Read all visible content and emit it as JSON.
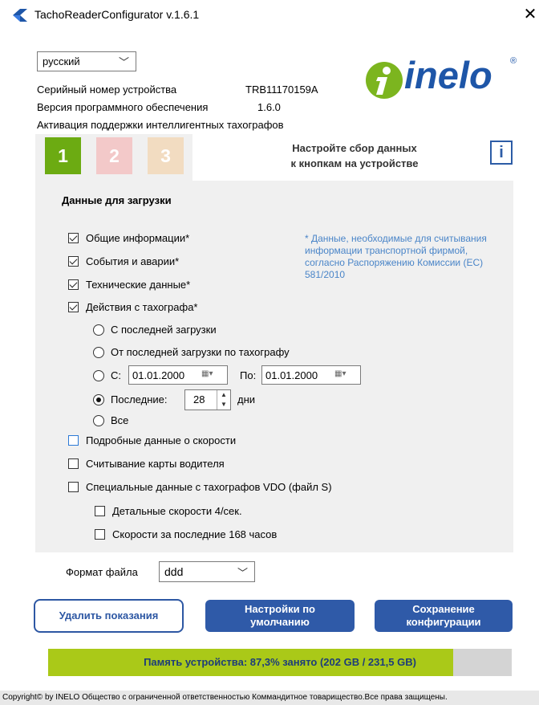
{
  "window": {
    "title": "TachoReaderConfigurator v.1.6.1",
    "close_glyph": "✕"
  },
  "language": {
    "selected": "русский"
  },
  "device": {
    "serial_label": "Серийный номер устройства",
    "serial_value": "TRB11170159A",
    "firmware_label": "Версия программного обеспечения",
    "firmware_value": "1.6.0",
    "smart_tacho_label": "Активация поддержки интеллигентных тахографов"
  },
  "logo": {
    "text": "inelo",
    "reg": "®",
    "brand_color": "#1e56a8",
    "accent_color": "#7cb51f"
  },
  "tabs": [
    {
      "label": "1",
      "color": "#6cab12"
    },
    {
      "label": "2",
      "color": "#f3c9c9"
    },
    {
      "label": "3",
      "color": "#f2dcc1"
    }
  ],
  "hint": {
    "line1": "Настройте сбор данных",
    "line2": "к кнопкам на устройстве"
  },
  "info_button": {
    "label": "i"
  },
  "download": {
    "title": "Данные для загрузки",
    "note": "* Данные, необходимые для считывания информации транспортной фирмой, согласно Распоряжению Комиссии (ЕС) 581/2010",
    "options": {
      "general": {
        "label": "Общие информации*",
        "checked": true
      },
      "events": {
        "label": "События и аварии*",
        "checked": true
      },
      "technical": {
        "label": "Технические данные*",
        "checked": true
      },
      "activities": {
        "label": "Действия с тахографа*",
        "checked": true
      },
      "detailed_speed": {
        "label": "Подробные данные о скорости",
        "checked": false
      },
      "driver_card": {
        "label": "Считывание карты водителя",
        "checked": false
      },
      "vdo_special": {
        "label": "Специальные данные с тахографов VDO (файл S)",
        "checked": false
      },
      "speed_4s": {
        "label": "Детальные скорости 4/сек.",
        "checked": false
      },
      "speed_168h": {
        "label": "Скорости за последние 168 часов",
        "checked": false
      }
    },
    "range": {
      "since_last": "С последней загрузки",
      "since_last_tacho": "От последней загрузки по тахографу",
      "from_label": "С:",
      "from_value": "01.01.2000",
      "to_label": "По:",
      "to_value": "01.01.2000",
      "last_label": "Последние:",
      "last_value": "28",
      "days_label": "дни",
      "all_label": "Все",
      "selected": "last"
    }
  },
  "file_format": {
    "label": "Формат файла",
    "value": "ddd"
  },
  "buttons": {
    "delete": "Удалить показания",
    "defaults_line1": "Настройки по",
    "defaults_line2": "умолчанию",
    "save_line1": "Сохранение",
    "save_line2": "конфигурации"
  },
  "memory": {
    "text": "Память устройства: 87,3% занято (202 GB / 231,5 GB)",
    "used_fraction": 0.873
  },
  "footer": "Copyright© by INELO Общество с ограниченной ответственностью Коммандитное товарищество.Все права защищены."
}
